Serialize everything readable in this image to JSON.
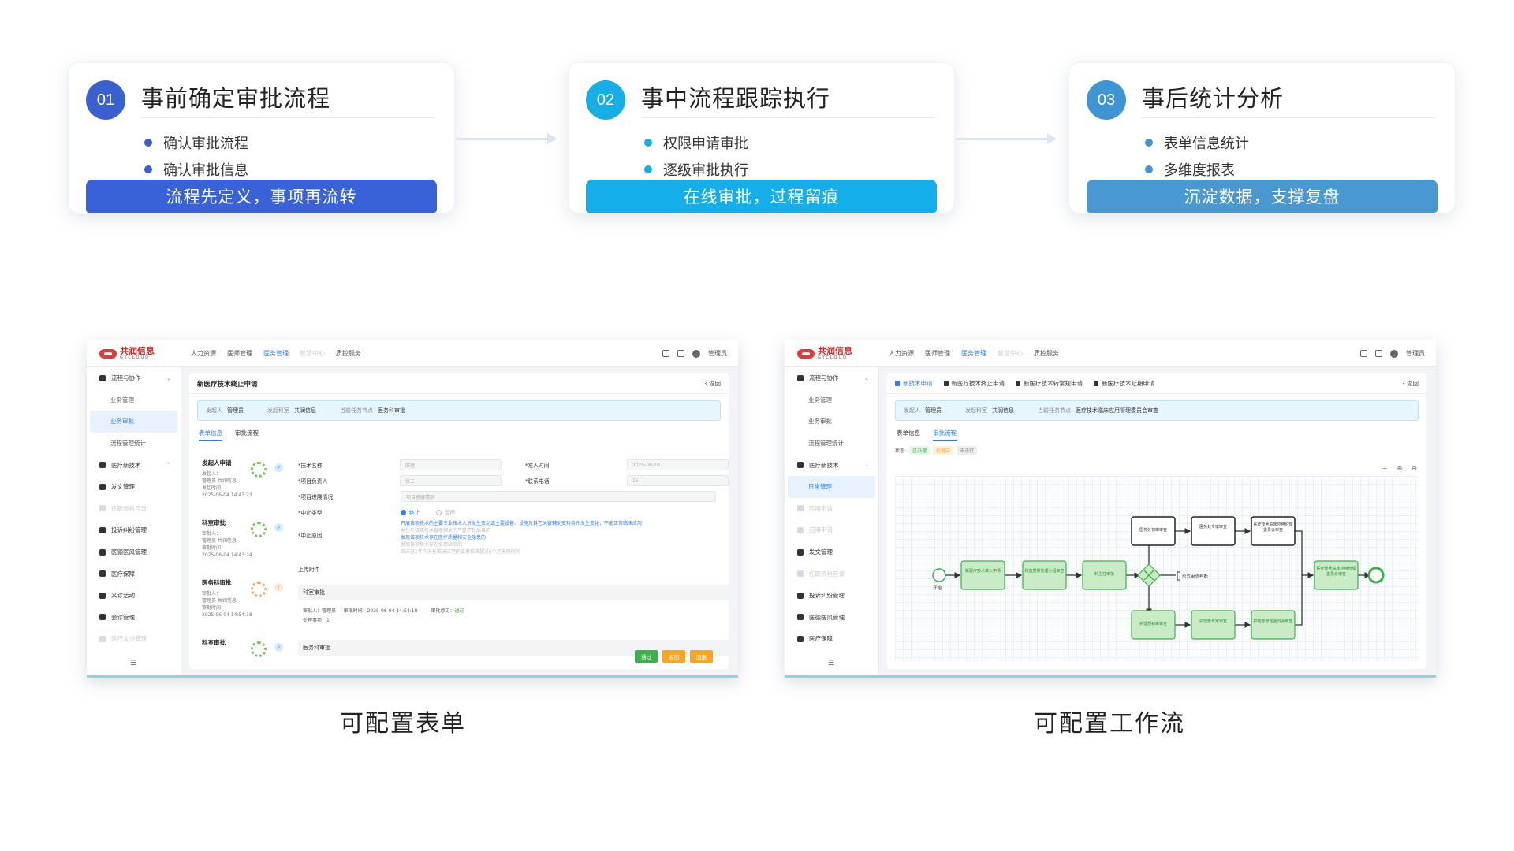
{
  "steps": [
    {
      "num": "01",
      "title": "事前确定审批流程",
      "bullets": [
        "确认审批流程",
        "确认审批信息"
      ],
      "banner": "流程先定义，事项再流转",
      "num_color": "#3a5fcf",
      "banner_color": "#3a62d8",
      "dot_color": "#3a5fcf"
    },
    {
      "num": "02",
      "title": "事中流程跟踪执行",
      "bullets": [
        "权限申请审批",
        "逐级审批执行"
      ],
      "banner": "在线审批，过程留痕",
      "num_color": "#17aee8",
      "banner_color": "#14aeea",
      "dot_color": "#17aee8"
    },
    {
      "num": "03",
      "title": "事后统计分析",
      "bullets": [
        "表单信息统计",
        "多维度报表"
      ],
      "banner": "沉淀数据，支撑复盘",
      "num_color": "#3f94d4",
      "banner_color": "#4a98d2",
      "dot_color": "#3f94d4"
    }
  ],
  "captions": {
    "left": "可配置表单",
    "right": "可配置工作流"
  },
  "app": {
    "logo_text": "共润信息",
    "logo_sub": "GYCLOUD",
    "nav_tabs": [
      "人力资源",
      "医师管理",
      "医务管理",
      "智慧中心",
      "质控服务"
    ],
    "user": "管理员",
    "sidebar_left": [
      {
        "label": "流程与协作",
        "type": "group",
        "chevron": "⌄"
      },
      {
        "label": "业务管理",
        "type": "sub"
      },
      {
        "label": "业务审批",
        "type": "sub-active"
      },
      {
        "label": "流程管理统计",
        "type": "sub"
      },
      {
        "label": "医疗新技术",
        "type": "group",
        "chevron": "⌃"
      },
      {
        "label": "发文管理",
        "type": "group"
      },
      {
        "label": "任职资格目录",
        "type": "faded"
      },
      {
        "label": "投诉纠纷管理",
        "type": "group"
      },
      {
        "label": "医德医风管理",
        "type": "group"
      },
      {
        "label": "医疗保障",
        "type": "group"
      },
      {
        "label": "义诊活动",
        "type": "group"
      },
      {
        "label": "会诊管理",
        "type": "group"
      },
      {
        "label": "医疗文书管理",
        "type": "faded"
      }
    ],
    "sidebar_right": [
      {
        "label": "流程与协作",
        "type": "group",
        "chevron": "⌄"
      },
      {
        "label": "业务管理",
        "type": "sub"
      },
      {
        "label": "业务审批",
        "type": "sub"
      },
      {
        "label": "流程管理统计",
        "type": "sub"
      },
      {
        "label": "医疗新技术",
        "type": "group",
        "chevron": "⌄"
      },
      {
        "label": "日常管理",
        "type": "sub-active"
      },
      {
        "label": "应用申请",
        "type": "faded"
      },
      {
        "label": "应用申请",
        "type": "faded"
      },
      {
        "label": "发文管理",
        "type": "group"
      },
      {
        "label": "任职资格目录",
        "type": "faded"
      },
      {
        "label": "投诉纠纷管理",
        "type": "group"
      },
      {
        "label": "医德医风管理",
        "type": "group"
      },
      {
        "label": "医疗保障",
        "type": "group"
      }
    ],
    "collapse_icon": "☰",
    "back": "‹ 返回"
  },
  "form": {
    "title": "新医疗技术终止申请",
    "info": [
      {
        "label": "发起人",
        "value": "管理员"
      },
      {
        "label": "发起科室",
        "value": "共润信息"
      },
      {
        "label": "当前任务节点",
        "value": "医务科审批"
      }
    ],
    "tabs": [
      "表单信息",
      "审批流程"
    ],
    "timeline": [
      {
        "name": "发起人申请",
        "l1": "发起人：",
        "l2": "管理员 共润信息",
        "l3": "发起时间：",
        "l4": "2025-06-04 14:43:23",
        "seal": "#7fc36b"
      },
      {
        "name": "科室审批",
        "l1": "审批人：",
        "l2": "管理员 共润信息",
        "l3": "审批时间：",
        "l4": "2025-06-04 14:43:24",
        "seal": "#7fc36b"
      },
      {
        "name": "医务科审批",
        "l1": "审批人：",
        "l2": "管理员 共润信息",
        "l3": "审批时间：",
        "l4": "2025-06-04 14:54:18",
        "seal": "#f0a673"
      },
      {
        "name": "科室审批",
        "l1": "",
        "l2": "",
        "l3": "",
        "l4": "",
        "seal": "#7fc36b"
      }
    ],
    "fields": {
      "tech_name_label": "*技术名称",
      "tech_name_value": "肝癌",
      "entry_time_label": "*准入时间",
      "entry_time_value": "2025-06-10",
      "owner_label": "*项目负责人",
      "owner_value": "张三",
      "phone_label": "*联系电话",
      "phone_value": "16",
      "progress_label": "*项目进展情况",
      "progress_value": "项目进展情况",
      "stop_type_label": "*中止类型",
      "stop_type_options": [
        "终止",
        "暂停"
      ],
      "reason_label": "*中止原因",
      "reasons": [
        "开展该项技术的主要专业技术人员发生变动或主要设备、设施及其它关键辅助支持条件发生变化，不能正常临床应用",
        "发生与该项技术直接相关的严重不良后果的",
        "发现该项技术存在医疗质量和安全隐患的",
        "发现该项技术存在伦理缺陷的",
        "临床已1年内未在临床应用的或者临床超过6个月无病例的"
      ],
      "attach_label": "上传附件"
    },
    "section1": "科室审批",
    "approval": {
      "approver": "审批人：管理员",
      "time": "审批时间：2025-06-04 14:54:18",
      "opinion": "审批意见：",
      "opinion_value": "通过",
      "point": "处理事项：1"
    },
    "section2": "医务科审批",
    "buttons": [
      {
        "label": "通过",
        "color": "#3cb14a"
      },
      {
        "label": "驳回",
        "color": "#f5a623"
      },
      {
        "label": "回退",
        "color": "#f5a623"
      }
    ]
  },
  "workflow": {
    "tabs": [
      "新技术申请",
      "新医疗技术终止申请",
      "新医疗技术转常规申请",
      "新医疗技术延期申请"
    ],
    "info": [
      {
        "label": "发起人",
        "value": "管理员"
      },
      {
        "label": "发起科室",
        "value": "共润信息"
      },
      {
        "label": "当前任务节点",
        "value": "医疗技术临床应用管理委员会审查"
      }
    ],
    "subtabs": [
      "表单信息",
      "审批流程"
    ],
    "status_label": "状态:",
    "status_chips": [
      {
        "label": "已办理",
        "color": "#3cb14a",
        "bg": "#e6f6e8"
      },
      {
        "label": "处理中",
        "color": "#f5a623",
        "bg": "#fdf1dc"
      },
      {
        "label": "未进行",
        "color": "#888888",
        "bg": "#eeeeee"
      }
    ],
    "controls": [
      "+",
      "⊕",
      "⊖"
    ],
    "nodes_done": [
      "新医疗技术准入申请",
      "科室质量管理小组审查",
      "科主任审批",
      "护理部初审审查",
      "护理部专家审查",
      "护理部管理委员会审查",
      "医疗技术临床应用管理委员会审查"
    ],
    "nodes_pending": [
      "医务处初审审查",
      "医务处专家审查",
      "医疗技术临床应用伦理委员会审查"
    ],
    "start_label": "开始",
    "condition_label": "形式审查判断"
  }
}
